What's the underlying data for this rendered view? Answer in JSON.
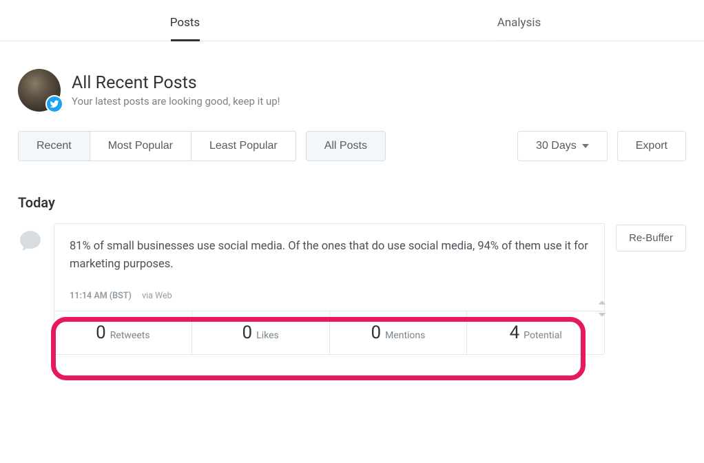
{
  "tabs": {
    "posts": "Posts",
    "analysis": "Analysis"
  },
  "header": {
    "title": "All Recent Posts",
    "subtitle": "Your latest posts are looking good, keep it up!"
  },
  "filters": {
    "recent": "Recent",
    "most_popular": "Most Popular",
    "least_popular": "Least Popular",
    "all_posts": "All Posts",
    "range": "30 Days",
    "export": "Export"
  },
  "section": {
    "today": "Today"
  },
  "post": {
    "text": "81% of small businesses use social media. Of the ones that do use social media, 94% of them use it for marketing purposes.",
    "time": "11:14 AM (BST)",
    "via": "via Web",
    "rebuffer": "Re-Buffer",
    "stats": {
      "retweets": {
        "value": "0",
        "label": "Retweets"
      },
      "likes": {
        "value": "0",
        "label": "Likes"
      },
      "mentions": {
        "value": "0",
        "label": "Mentions"
      },
      "potential": {
        "value": "4",
        "label": "Potential"
      }
    }
  }
}
